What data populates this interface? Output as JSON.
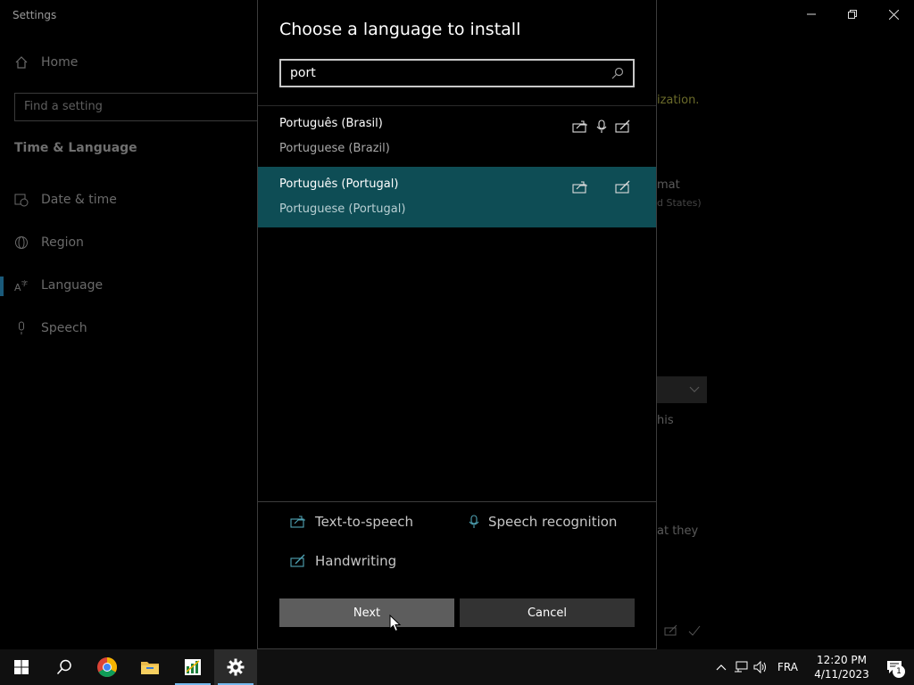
{
  "window": {
    "title": "Settings"
  },
  "sidebar": {
    "home": "Home",
    "search_placeholder": "Find a setting",
    "section": "Time & Language",
    "items": [
      {
        "label": "Date & time",
        "icon": "calendar-clock-icon"
      },
      {
        "label": "Region",
        "icon": "globe-icon"
      },
      {
        "label": "Language",
        "icon": "language-icon"
      },
      {
        "label": "Speech",
        "icon": "microphone-icon"
      }
    ]
  },
  "background": {
    "snippets": [
      "ization.",
      "mat",
      "d States)",
      "his",
      "at they"
    ]
  },
  "dialog": {
    "title": "Choose a language to install",
    "search_value": "port",
    "languages": [
      {
        "native": "Português (Brasil)",
        "english": "Portuguese (Brazil)",
        "tts": true,
        "speech": true,
        "handwriting": true,
        "selected": false
      },
      {
        "native": "Português (Portugal)",
        "english": "Portuguese (Portugal)",
        "tts": true,
        "speech": false,
        "handwriting": true,
        "selected": true
      }
    ],
    "legend": {
      "tts": "Text-to-speech",
      "speech": "Speech recognition",
      "handwriting": "Handwriting"
    },
    "next_label": "Next",
    "cancel_label": "Cancel"
  },
  "taskbar": {
    "language": "FRA",
    "time": "12:20 PM",
    "date": "4/11/2023",
    "notification_count": "1"
  },
  "colors": {
    "selected_row": "#0e4d55",
    "accent": "#76b9ed"
  }
}
